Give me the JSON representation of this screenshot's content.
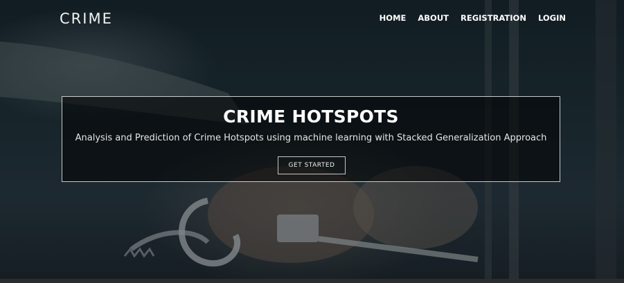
{
  "brand": {
    "name": "CRIME"
  },
  "nav": {
    "items": [
      "HOME",
      "ABOUT",
      "REGISTRATION",
      "LOGIN"
    ]
  },
  "hero": {
    "title": "CRIME HOTSPOTS",
    "subtitle": "Analysis and Prediction of Crime Hotspots using machine learning with Stacked Generalization Approach",
    "cta_label": "GET STARTED",
    "background_image": "handcuffs-photo"
  },
  "colors": {
    "text": "#ffffff",
    "banner_bg": "rgba(0,0,0,0.52)",
    "border": "#ebebeb"
  }
}
